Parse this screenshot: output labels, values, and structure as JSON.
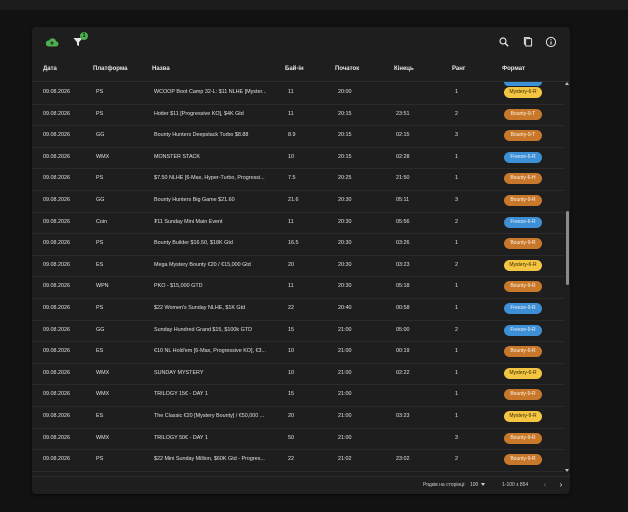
{
  "toolbar": {
    "icons": [
      "cloud-upload-icon",
      "filter-icon",
      "search-icon",
      "copy-icon",
      "info-icon"
    ],
    "filter_badge": "1",
    "badge_color": "#4caf50"
  },
  "columns": [
    "Дата",
    "Платформа",
    "Назва",
    "Бай-ін",
    "Початок",
    "Кінець",
    "Ранг",
    "Формат"
  ],
  "rows": [
    {
      "date": "09.08.2026",
      "platform": "PS",
      "name": "WCOOP Boot Camp 32-L: $11 NLHE [Myster...",
      "buyin": "11",
      "start": "20:00",
      "end": "",
      "rank": "1",
      "format": "Mystery-6-R",
      "color": "gold"
    },
    {
      "date": "09.08.2026",
      "platform": "PS",
      "name": "Hotter $11 [Progressive KO], $4K Gtd",
      "buyin": "11",
      "start": "20:15",
      "end": "23:51",
      "rank": "2",
      "format": "Bounty-9-T",
      "color": "orange"
    },
    {
      "date": "09.08.2026",
      "platform": "GG",
      "name": "Bounty Hunters Deepstack Turbo $8.88",
      "buyin": "8.9",
      "start": "20:15",
      "end": "02:15",
      "rank": "3",
      "format": "Bounty-9-T",
      "color": "orange"
    },
    {
      "date": "09.08.2026",
      "platform": "WMX",
      "name": "MONSTER STACK",
      "buyin": "10",
      "start": "20:15",
      "end": "02:28",
      "rank": "1",
      "format": "Freeze-6-R",
      "color": "blue"
    },
    {
      "date": "09.08.2026",
      "platform": "PS",
      "name": "$7.50 NLHE [6-Max, Hyper-Turbo, Progressi...",
      "buyin": "7.5",
      "start": "20:25",
      "end": "21:50",
      "rank": "1",
      "format": "Bounty-6-H",
      "color": "orange"
    },
    {
      "date": "09.08.2026",
      "platform": "GG",
      "name": "Bounty Hunters Big Game $21.60",
      "buyin": "21.6",
      "start": "20:30",
      "end": "05:11",
      "rank": "3",
      "format": "Bounty-9-R",
      "color": "orange"
    },
    {
      "date": "09.08.2026",
      "platform": "Coin",
      "name": "₮11 Sunday Mini Main Event",
      "buyin": "11",
      "start": "20:30",
      "end": "05:56",
      "rank": "2",
      "format": "Freeze-6-R",
      "color": "blue"
    },
    {
      "date": "09.08.2026",
      "platform": "PS",
      "name": "Bounty Builder $16.50, $18K Gtd",
      "buyin": "16.5",
      "start": "20:30",
      "end": "03:26",
      "rank": "1",
      "format": "Bounty-9-R",
      "color": "orange"
    },
    {
      "date": "09.08.2026",
      "platform": "ES",
      "name": "Mega Mystery Bounty €20 / €15,000 Gtd",
      "buyin": "20",
      "start": "20:30",
      "end": "03:23",
      "rank": "2",
      "format": "Mystery-6-R",
      "color": "gold"
    },
    {
      "date": "09.08.2026",
      "platform": "WPN",
      "name": "PKO - $15,000 GTD",
      "buyin": "11",
      "start": "20:30",
      "end": "05:18",
      "rank": "1",
      "format": "Bounty-9-R",
      "color": "orange"
    },
    {
      "date": "09.08.2026",
      "platform": "PS",
      "name": "$22 Women's Sunday NLHE, $1K Gtd",
      "buyin": "22",
      "start": "20:40",
      "end": "00:58",
      "rank": "1",
      "format": "Freeze-9-R",
      "color": "blue"
    },
    {
      "date": "09.08.2026",
      "platform": "GG",
      "name": "Sunday Hundred Grand $15, $100k GTD",
      "buyin": "15",
      "start": "21:00",
      "end": "05:00",
      "rank": "2",
      "format": "Freeze-9-R",
      "color": "blue"
    },
    {
      "date": "09.08.2026",
      "platform": "ES",
      "name": "€10 NL Hold'em [6-Max, Progressive KO], €3...",
      "buyin": "10",
      "start": "21:00",
      "end": "00:19",
      "rank": "1",
      "format": "Bounty-6-R",
      "color": "orange"
    },
    {
      "date": "09.08.2026",
      "platform": "WMX",
      "name": "SUNDAY MYSTERY",
      "buyin": "10",
      "start": "21:00",
      "end": "02:22",
      "rank": "1",
      "format": "Mystery-6-R",
      "color": "gold"
    },
    {
      "date": "09.08.2026",
      "platform": "WMX",
      "name": "TRILOGY 15€ - DAY 1",
      "buyin": "15",
      "start": "21:00",
      "end": "",
      "rank": "1",
      "format": "Bounty-9-R",
      "color": "orange"
    },
    {
      "date": "09.08.2026",
      "platform": "ES",
      "name": "The Classic €20 [Mystery Bounty] / €50,000 ...",
      "buyin": "20",
      "start": "21:00",
      "end": "03:23",
      "rank": "1",
      "format": "Mystery-9-R",
      "color": "gold"
    },
    {
      "date": "09.08.2026",
      "platform": "WMX",
      "name": "TRILOGY 50€ - DAY 1",
      "buyin": "50",
      "start": "21:00",
      "end": "",
      "rank": "3",
      "format": "Bounty-9-R",
      "color": "orange"
    },
    {
      "date": "09.08.2026",
      "platform": "PS",
      "name": "$22 Mini Sunday Million, $60K Gtd - Progres...",
      "buyin": "22",
      "start": "21:02",
      "end": "23:02",
      "rank": "2",
      "format": "Bounty-9-R",
      "color": "orange"
    }
  ],
  "footer": {
    "rows_per_page_label": "Рядків на сторінці:",
    "rows_per_page": "100",
    "range": "1-100 з 854",
    "prev_icon": "chevron-left-icon",
    "next_icon": "chevron-right-icon"
  },
  "colors": {
    "gold": "#f4c542",
    "orange": "#c8782b",
    "blue": "#3d8fd6",
    "panel": "#1e1e1e",
    "background": "#121212"
  }
}
